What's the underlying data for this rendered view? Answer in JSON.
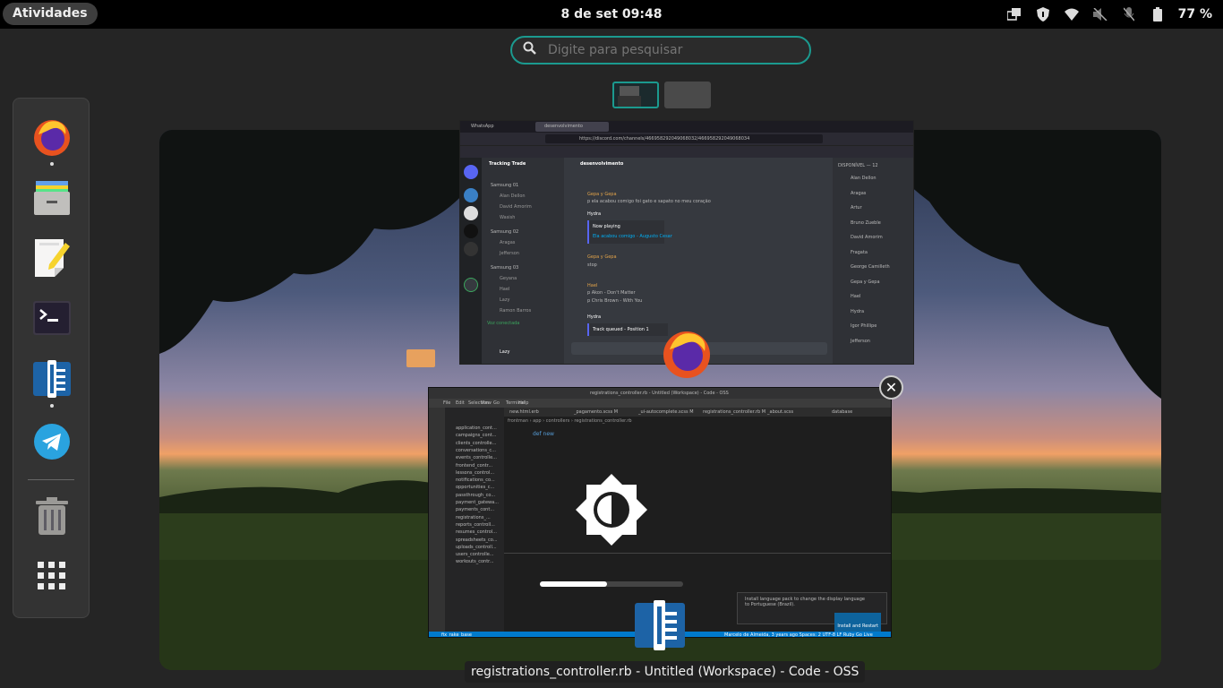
{
  "topbar": {
    "activities_label": "Atividades",
    "clock": "8 de set  09:48",
    "battery_percent": "77 %",
    "tray_icons": [
      "window-switch-icon",
      "shield-icon",
      "wifi-icon",
      "speaker-muted-icon",
      "mic-muted-icon",
      "battery-icon"
    ]
  },
  "search": {
    "placeholder": "Digite para pesquisar"
  },
  "workspaces": {
    "count": 2,
    "active_index": 0
  },
  "dash": {
    "items": [
      {
        "name": "firefox",
        "icon": "firefox-icon",
        "running": true
      },
      {
        "name": "files",
        "icon": "files-icon",
        "running": false
      },
      {
        "name": "text-editor",
        "icon": "text-editor-icon",
        "running": false
      },
      {
        "name": "terminal",
        "icon": "terminal-icon",
        "running": false
      },
      {
        "name": "code-oss",
        "icon": "code-icon",
        "running": true
      },
      {
        "name": "telegram",
        "icon": "telegram-icon",
        "running": false
      },
      {
        "name": "trash",
        "icon": "trash-icon",
        "running": false
      },
      {
        "name": "show-apps",
        "icon": "app-grid-icon",
        "running": false
      }
    ]
  },
  "windows": {
    "discord": {
      "tabs": [
        "WhatsApp",
        "desenvolvimento"
      ],
      "url": "https://discord.com/channels/466958292049068032/466958292049068034",
      "server": "Tracking Trade",
      "channel": "desenvolvimento",
      "voice_groups": [
        {
          "name": "Samsung 01",
          "users": [
            "Alan Dellon",
            "David Amorim",
            "Wasish"
          ]
        },
        {
          "name": "Samsung 02",
          "users": [
            "Aragas",
            "Jefferson"
          ]
        },
        {
          "name": "Samsung 03",
          "users": [
            "Geyana",
            "Hael",
            "Lazy",
            "Ramon Barros"
          ]
        }
      ],
      "messages": [
        {
          "author": "Gepa y Gepa",
          "text": "p ela acabou comigo foi gato e sapato no meu coração"
        },
        {
          "author": "Hydra",
          "embed_title": "Now playing",
          "embed_text": "Ela acabou comigo - Augusto Cesar"
        },
        {
          "author": "Gepa y Gepa",
          "text": "stop"
        },
        {
          "author": "Hael",
          "text": "p Akon - Don't Matter"
        },
        {
          "author": "Hael",
          "text": "p Chris Brown - With You"
        },
        {
          "author": "Hydra",
          "embed_title": "Track queued - Position 1"
        }
      ],
      "members_header": "DISPONÍVEL — 12",
      "members": [
        "Alan Dellon",
        "Aragas",
        "Artur",
        "Bruno Zueble",
        "David Amorim",
        "Fragata",
        "George Camilleth",
        "Gepa y Gepa",
        "Hael",
        "Hydra",
        "Igor Phillipe",
        "Jefferson"
      ],
      "voice_status": "Voz conectada",
      "user": "Lazy"
    },
    "code": {
      "title": "registrations_controller.rb - Untitled (Workspace) - Code - OSS",
      "menu": [
        "File",
        "Edit",
        "Selection",
        "View",
        "Go",
        "Terminal",
        "Help"
      ],
      "tabs": [
        "new.html.erb",
        "_pagamento.scss M",
        "_ui-autocomplete.scss M",
        "registrations_controller.rb M",
        "_about.scss",
        "database"
      ],
      "breadcrumb": "frontman › app › controllers › registrations_controller.rb",
      "files": [
        "application_cont...",
        "campaigns_cont...",
        "clients_controlle...",
        "conversations_c...",
        "events_controlle...",
        "frontend_contr...",
        "lessons_control...",
        "notifications_co...",
        "opportunities_c...",
        "passthrough_co...",
        "payment_gatewa...",
        "payments_cont...",
        "registrations_...",
        "reports_controll...",
        "resumes_control...",
        "spreadsheets_co...",
        "uploads_controll...",
        "users_controlle...",
        "workouts_contr..."
      ],
      "code_lines": [
        "def new",
        "",
        "",
        "",
        "",
        "",
        "",
        ""
      ],
      "notification": "Install language pack to change the display language to Portuguese (Brazil).",
      "notification_button": "Install and Restart",
      "osd_progress": 0.47,
      "status_left": "fix_rake_base",
      "status_right": "Marcelo de Almeida, 3 years ago   Spaces: 2   UTF-8   LF   Ruby   Go Live"
    }
  },
  "hovered_window_caption": "registrations_controller.rb - Untitled (Workspace) - Code - OSS",
  "colors": {
    "accent": "#1b9a8f",
    "discord_bg": "#36393f",
    "vscode_status": "#007acc"
  }
}
